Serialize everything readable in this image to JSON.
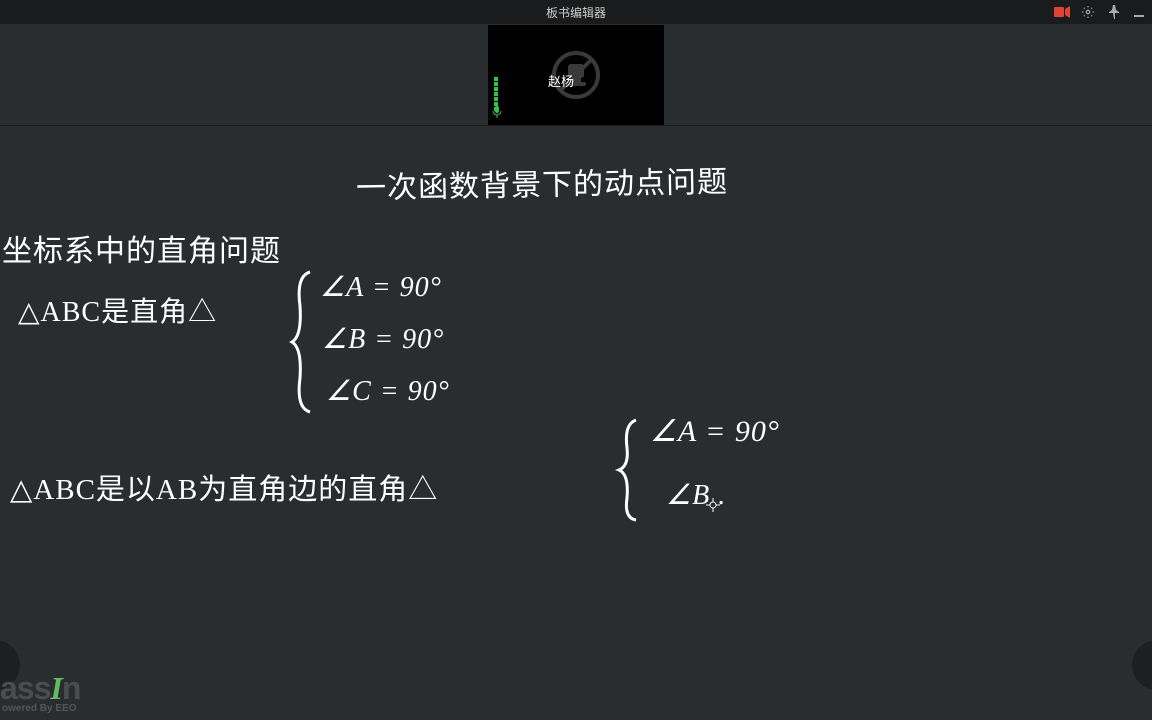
{
  "titlebar": {
    "title": "板书编辑器"
  },
  "video": {
    "name": "赵杨"
  },
  "board": {
    "line_title": "一次函数背景下的动点问题",
    "line_sub1": "坐标系中的直角问题",
    "line_case1": "△ABC是直角△",
    "angleA1": "∠A = 90°",
    "angleB1": "∠B = 90°",
    "angleC1": "∠C = 90°",
    "line_case2": "△ABC是以AB为直角边的直角△",
    "angleA2": "∠A = 90°",
    "angleB2": "∠B ."
  },
  "logo": {
    "brand": "assIn",
    "tagline": "owered By EEO"
  }
}
